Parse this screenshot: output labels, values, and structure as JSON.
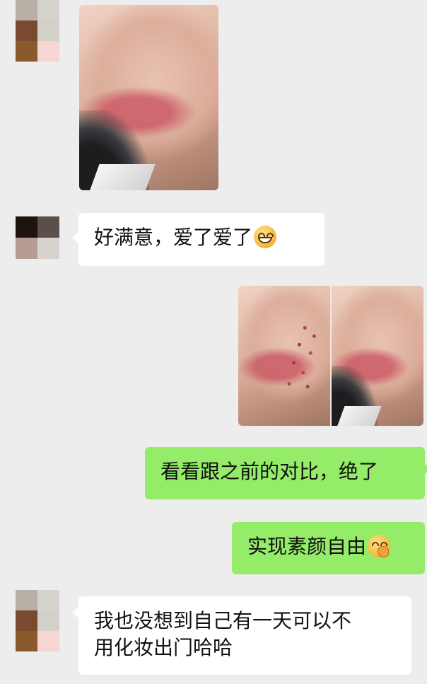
{
  "chat": {
    "messages": [
      {
        "side": "left",
        "type": "image",
        "alt": "photo-1"
      },
      {
        "side": "left",
        "type": "text",
        "text": "好满意，爱了爱了",
        "emoji": "grinning-face-icon"
      },
      {
        "side": "right",
        "type": "image",
        "alt": "comparison-photo"
      },
      {
        "side": "right",
        "type": "text",
        "text": "看看跟之前的对比，绝了"
      },
      {
        "side": "right",
        "type": "text",
        "text": "实现素颜自由",
        "emoji": "thinking-face-icon"
      },
      {
        "side": "left",
        "type": "text",
        "line1": "我也没想到自己有一天可以不",
        "line2": "用化妆出门哈哈"
      }
    ]
  },
  "colors": {
    "background": "#ededed",
    "bubble_white": "#ffffff",
    "bubble_green": "#95ec69"
  }
}
